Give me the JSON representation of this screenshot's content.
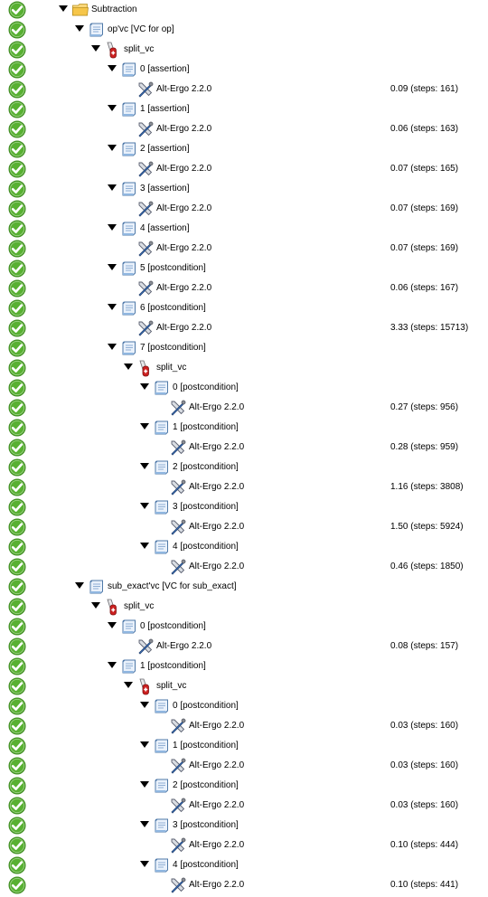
{
  "tree": [
    {
      "depth": 0,
      "kind": "theory",
      "status": "valid",
      "label": "Subtraction",
      "expandable": true
    },
    {
      "depth": 1,
      "kind": "goal",
      "status": "valid",
      "label": "op'vc [VC for op]",
      "expandable": true
    },
    {
      "depth": 2,
      "kind": "transformation",
      "status": "valid",
      "label": "split_vc",
      "expandable": true
    },
    {
      "depth": 3,
      "kind": "goal",
      "status": "valid",
      "label": "0 [assertion]",
      "expandable": true
    },
    {
      "depth": 4,
      "kind": "prover",
      "status": "valid",
      "label": "Alt-Ergo 2.2.0",
      "time": "0.09 (steps: 161)"
    },
    {
      "depth": 3,
      "kind": "goal",
      "status": "valid",
      "label": "1 [assertion]",
      "expandable": true
    },
    {
      "depth": 4,
      "kind": "prover",
      "status": "valid",
      "label": "Alt-Ergo 2.2.0",
      "time": "0.06 (steps: 163)"
    },
    {
      "depth": 3,
      "kind": "goal",
      "status": "valid",
      "label": "2 [assertion]",
      "expandable": true
    },
    {
      "depth": 4,
      "kind": "prover",
      "status": "valid",
      "label": "Alt-Ergo 2.2.0",
      "time": "0.07 (steps: 165)"
    },
    {
      "depth": 3,
      "kind": "goal",
      "status": "valid",
      "label": "3 [assertion]",
      "expandable": true
    },
    {
      "depth": 4,
      "kind": "prover",
      "status": "valid",
      "label": "Alt-Ergo 2.2.0",
      "time": "0.07 (steps: 169)"
    },
    {
      "depth": 3,
      "kind": "goal",
      "status": "valid",
      "label": "4 [assertion]",
      "expandable": true
    },
    {
      "depth": 4,
      "kind": "prover",
      "status": "valid",
      "label": "Alt-Ergo 2.2.0",
      "time": "0.07 (steps: 169)"
    },
    {
      "depth": 3,
      "kind": "goal",
      "status": "valid",
      "label": "5 [postcondition]",
      "expandable": true
    },
    {
      "depth": 4,
      "kind": "prover",
      "status": "valid",
      "label": "Alt-Ergo 2.2.0",
      "time": "0.06 (steps: 167)"
    },
    {
      "depth": 3,
      "kind": "goal",
      "status": "valid",
      "label": "6 [postcondition]",
      "expandable": true
    },
    {
      "depth": 4,
      "kind": "prover",
      "status": "valid",
      "label": "Alt-Ergo 2.2.0",
      "time": "3.33 (steps: 15713)"
    },
    {
      "depth": 3,
      "kind": "goal",
      "status": "valid",
      "label": "7 [postcondition]",
      "expandable": true
    },
    {
      "depth": 4,
      "kind": "transformation",
      "status": "valid",
      "label": "split_vc",
      "expandable": true
    },
    {
      "depth": 5,
      "kind": "goal",
      "status": "valid",
      "label": "0 [postcondition]",
      "expandable": true
    },
    {
      "depth": 6,
      "kind": "prover",
      "status": "valid",
      "label": "Alt-Ergo 2.2.0",
      "time": "0.27 (steps: 956)"
    },
    {
      "depth": 5,
      "kind": "goal",
      "status": "valid",
      "label": "1 [postcondition]",
      "expandable": true
    },
    {
      "depth": 6,
      "kind": "prover",
      "status": "valid",
      "label": "Alt-Ergo 2.2.0",
      "time": "0.28 (steps: 959)"
    },
    {
      "depth": 5,
      "kind": "goal",
      "status": "valid",
      "label": "2 [postcondition]",
      "expandable": true
    },
    {
      "depth": 6,
      "kind": "prover",
      "status": "valid",
      "label": "Alt-Ergo 2.2.0",
      "time": "1.16 (steps: 3808)"
    },
    {
      "depth": 5,
      "kind": "goal",
      "status": "valid",
      "label": "3 [postcondition]",
      "expandable": true
    },
    {
      "depth": 6,
      "kind": "prover",
      "status": "valid",
      "label": "Alt-Ergo 2.2.0",
      "time": "1.50 (steps: 5924)"
    },
    {
      "depth": 5,
      "kind": "goal",
      "status": "valid",
      "label": "4 [postcondition]",
      "expandable": true
    },
    {
      "depth": 6,
      "kind": "prover",
      "status": "valid",
      "label": "Alt-Ergo 2.2.0",
      "time": "0.46 (steps: 1850)"
    },
    {
      "depth": 1,
      "kind": "goal",
      "status": "valid",
      "label": "sub_exact'vc [VC for sub_exact]",
      "expandable": true
    },
    {
      "depth": 2,
      "kind": "transformation",
      "status": "valid",
      "label": "split_vc",
      "expandable": true
    },
    {
      "depth": 3,
      "kind": "goal",
      "status": "valid",
      "label": "0 [postcondition]",
      "expandable": true
    },
    {
      "depth": 4,
      "kind": "prover",
      "status": "valid",
      "label": "Alt-Ergo 2.2.0",
      "time": "0.08 (steps: 157)"
    },
    {
      "depth": 3,
      "kind": "goal",
      "status": "valid",
      "label": "1 [postcondition]",
      "expandable": true
    },
    {
      "depth": 4,
      "kind": "transformation",
      "status": "valid",
      "label": "split_vc",
      "expandable": true
    },
    {
      "depth": 5,
      "kind": "goal",
      "status": "valid",
      "label": "0 [postcondition]",
      "expandable": true
    },
    {
      "depth": 6,
      "kind": "prover",
      "status": "valid",
      "label": "Alt-Ergo 2.2.0",
      "time": "0.03 (steps: 160)"
    },
    {
      "depth": 5,
      "kind": "goal",
      "status": "valid",
      "label": "1 [postcondition]",
      "expandable": true
    },
    {
      "depth": 6,
      "kind": "prover",
      "status": "valid",
      "label": "Alt-Ergo 2.2.0",
      "time": "0.03 (steps: 160)"
    },
    {
      "depth": 5,
      "kind": "goal",
      "status": "valid",
      "label": "2 [postcondition]",
      "expandable": true
    },
    {
      "depth": 6,
      "kind": "prover",
      "status": "valid",
      "label": "Alt-Ergo 2.2.0",
      "time": "0.03 (steps: 160)"
    },
    {
      "depth": 5,
      "kind": "goal",
      "status": "valid",
      "label": "3 [postcondition]",
      "expandable": true
    },
    {
      "depth": 6,
      "kind": "prover",
      "status": "valid",
      "label": "Alt-Ergo 2.2.0",
      "time": "0.10 (steps: 444)"
    },
    {
      "depth": 5,
      "kind": "goal",
      "status": "valid",
      "label": "4 [postcondition]",
      "expandable": true
    },
    {
      "depth": 6,
      "kind": "prover",
      "status": "valid",
      "label": "Alt-Ergo 2.2.0",
      "time": "0.10 (steps: 441)"
    }
  ],
  "colors": {
    "valid_green": "#58b032",
    "valid_green_dark": "#3f8a22",
    "folder_yellow": "#f6c64a",
    "scroll_blue": "#8fb6e0",
    "knife_red": "#cc2020"
  }
}
